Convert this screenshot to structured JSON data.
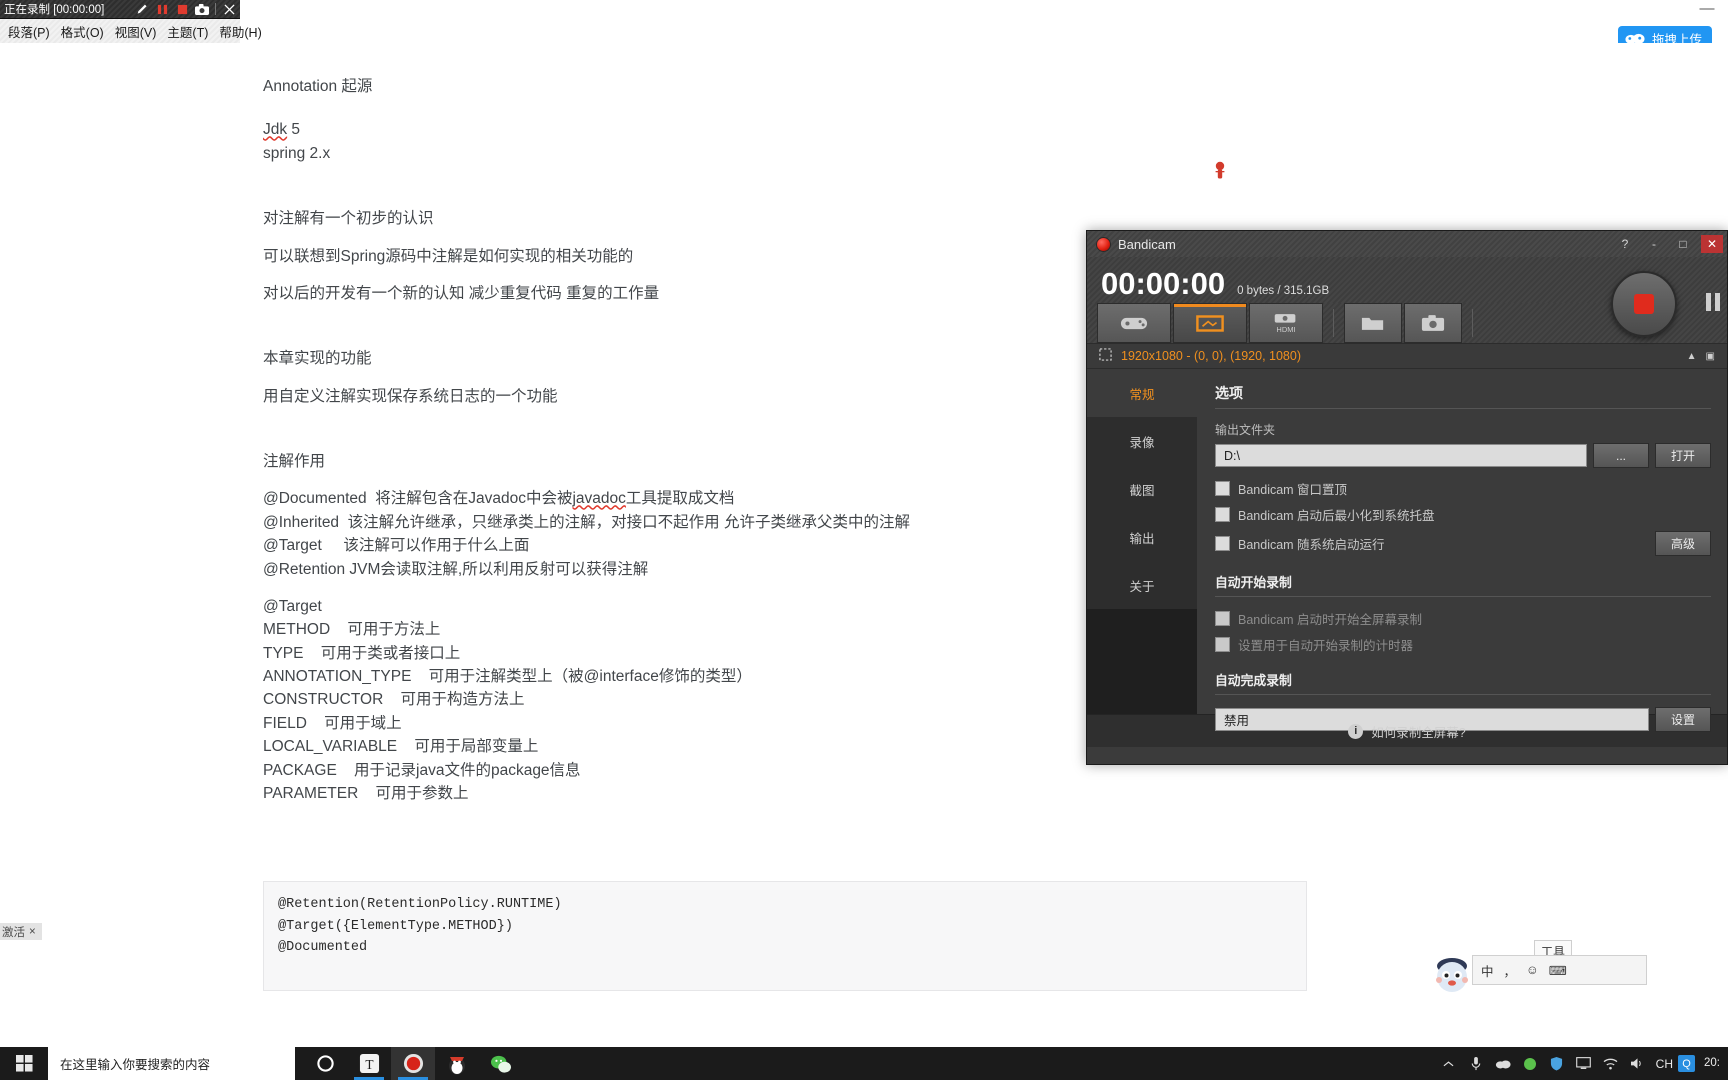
{
  "recorder_bar": {
    "title": "正在录制 [00:00:00]",
    "icons": [
      "pen-icon",
      "pause-icon",
      "stop-icon",
      "camera-icon",
      "close-icon"
    ]
  },
  "menu_bar": {
    "items": [
      {
        "label": "段落(P)",
        "name": "menu-paragraph"
      },
      {
        "label": "格式(O)",
        "name": "menu-format"
      },
      {
        "label": "视图(V)",
        "name": "menu-view"
      },
      {
        "label": "主题(T)",
        "name": "menu-theme"
      },
      {
        "label": "帮助(H)",
        "name": "menu-help"
      }
    ]
  },
  "titlebar": {
    "minimize_label": "—",
    "upload_label": "拖拽上传"
  },
  "document": {
    "blocks": [
      {
        "text": "Annotation 起源",
        "gap": "gap-none"
      },
      {
        "text": "Jdk 5",
        "gap": "gap-lg",
        "squiggle": "Jdk"
      },
      {
        "text": "spring 2.x",
        "gap": "gap-sm"
      },
      {
        "text": "对注解有一个初步的认识",
        "gap": "gap-xl"
      },
      {
        "text": "可以联想到Spring源码中注解是如何实现的相关功能的",
        "gap": "gap-md"
      },
      {
        "text": "对以后的开发有一个新的认知 减少重复代码 重复的工作量",
        "gap": "gap-md"
      },
      {
        "text": "本章实现的功能",
        "gap": "gap-xl"
      },
      {
        "text": "用自定义注解实现保存系统日志的一个功能",
        "gap": "gap-md"
      },
      {
        "text": "注解作用",
        "gap": "gap-xl"
      },
      {
        "text": "@Documented  将注解包含在Javadoc中会被javadoc工具提取成文档",
        "gap": "gap-md",
        "squiggle": "javadoc"
      },
      {
        "text": "@Inherited  该注解允许继承，只继承类上的注解，对接口不起作用 允许子类继承父类中的注解",
        "gap": "gap-sm"
      },
      {
        "text": "@Target     该注解可以作用于什么上面",
        "gap": "gap-sm"
      },
      {
        "text": "@Retention JVM会读取注解,所以利用反射可以获得注解",
        "gap": "gap-sm"
      },
      {
        "text": "@Target",
        "gap": "gap-md"
      },
      {
        "text": "METHOD    可用于方法上",
        "gap": "gap-sm"
      },
      {
        "text": "TYPE    可用于类或者接口上",
        "gap": "gap-sm"
      },
      {
        "text": "ANNOTATION_TYPE    可用于注解类型上（被@interface修饰的类型）",
        "gap": "gap-sm"
      },
      {
        "text": "CONSTRUCTOR    可用于构造方法上",
        "gap": "gap-sm"
      },
      {
        "text": "FIELD    可用于域上",
        "gap": "gap-sm"
      },
      {
        "text": "LOCAL_VARIABLE    可用于局部变量上",
        "gap": "gap-sm"
      },
      {
        "text": "PACKAGE    用于记录java文件的package信息",
        "gap": "gap-sm"
      },
      {
        "text": "PARAMETER    可用于参数上",
        "gap": "gap-sm"
      }
    ],
    "code_block": "@Retention(RetentionPolicy.RUNTIME)\n@Target({ElementType.METHOD})\n@Documented"
  },
  "activate_watermark": {
    "label": "激活",
    "close": "×"
  },
  "bandicam": {
    "title": "Bandicam",
    "window_buttons": {
      "help": "?",
      "minimize": "-",
      "maximize": "□",
      "close": "✕"
    },
    "time": "00:00:00",
    "size_info": "0 bytes / 315.1GB",
    "tabs": [
      {
        "name": "game-recording-tab",
        "icon": "gamepad-icon",
        "active": false
      },
      {
        "name": "screen-recording-tab",
        "icon": "screen-rect-icon",
        "active": true
      },
      {
        "name": "device-recording-tab",
        "icon": "hdmi-camera-icon",
        "label": "HDMI",
        "active": false
      },
      {
        "name": "open-folder-tab",
        "icon": "folder-icon",
        "active": false
      },
      {
        "name": "screenshot-tab",
        "icon": "camera-icon",
        "active": false
      }
    ],
    "resolution": "1920x1080 - (0, 0), (1920, 1080)",
    "sidebar": [
      {
        "label": "常规",
        "name": "sidebar-general",
        "active": true
      },
      {
        "label": "录像",
        "name": "sidebar-video",
        "active": false
      },
      {
        "label": "截图",
        "name": "sidebar-image",
        "active": false
      },
      {
        "label": "输出",
        "name": "sidebar-output",
        "active": false
      },
      {
        "label": "关于",
        "name": "sidebar-about",
        "active": false
      }
    ],
    "options": {
      "section_title": "选项",
      "output_folder_label": "输出文件夹",
      "output_folder_value": "D:\\",
      "browse_label": "...",
      "open_label": "打开",
      "advanced_label": "高级",
      "checkboxes": [
        {
          "label": "Bandicam 窗口置顶",
          "checked": false,
          "name": "chk-always-on-top"
        },
        {
          "label": "Bandicam 启动后最小化到系统托盘",
          "checked": false,
          "name": "chk-minimize-to-tray"
        },
        {
          "label": "Bandicam 随系统启动运行",
          "checked": false,
          "name": "chk-run-on-startup"
        }
      ],
      "auto_start_title": "自动开始录制",
      "auto_start_checkboxes": [
        {
          "label": "Bandicam 启动时开始全屏幕录制",
          "checked": false,
          "name": "chk-autostart-fullscreen"
        },
        {
          "label": "设置用于自动开始录制的计时器",
          "checked": false,
          "name": "chk-autostart-timer"
        }
      ],
      "auto_complete_title": "自动完成录制",
      "auto_complete_value": "禁用",
      "settings_label": "设置"
    },
    "footer": "如何录制全屏幕?"
  },
  "ime_popup": {
    "mode": "中",
    "items": [
      "中",
      "，",
      "☺",
      "⌨"
    ]
  },
  "tool_chip": {
    "label": "工具"
  },
  "taskbar": {
    "search_placeholder": "在这里输入你要搜索的内容",
    "apps": [
      {
        "name": "taskbar-cortana",
        "icon": "circle-icon"
      },
      {
        "name": "taskbar-typora",
        "icon": "typora-t-icon"
      },
      {
        "name": "taskbar-bandicam",
        "icon": "record-dot-icon"
      },
      {
        "name": "taskbar-qq",
        "icon": "penguin-icon"
      },
      {
        "name": "taskbar-wechat",
        "icon": "wechat-icon"
      }
    ],
    "tray": {
      "ime_label": "CH",
      "ime_badge": "Q",
      "clock_line1": "20:"
    }
  }
}
